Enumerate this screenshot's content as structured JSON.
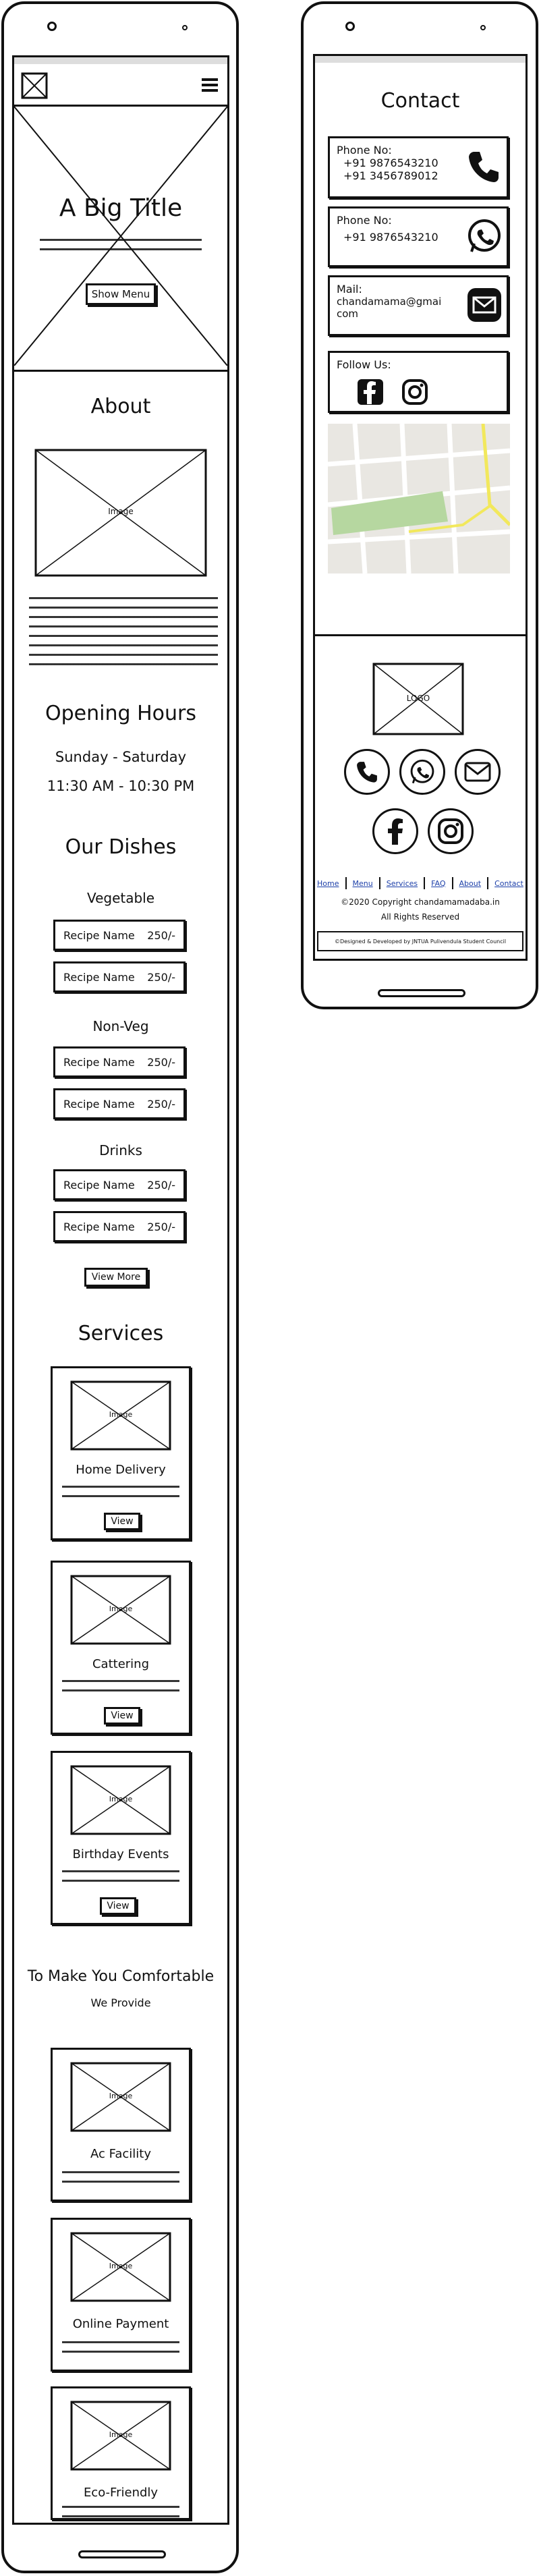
{
  "mobile_left": {
    "nav": {
      "logo_icon": "logo-placeholder-icon",
      "menu_icon": "hamburger-icon"
    },
    "hero": {
      "title": "A Big Title",
      "button": "Show Menu"
    },
    "about": {
      "heading": "About",
      "image_label": "Image"
    },
    "hours": {
      "heading": "Opening Hours",
      "days": "Sunday - Saturday",
      "time": "11:30 AM - 10:30 PM"
    },
    "dishes": {
      "heading": "Our Dishes",
      "groups": [
        {
          "title": "Vegetable",
          "items": [
            {
              "name": "Recipe Name",
              "price": "250/-"
            },
            {
              "name": "Recipe Name",
              "price": "250/-"
            }
          ]
        },
        {
          "title": "Non-Veg",
          "items": [
            {
              "name": "Recipe Name",
              "price": "250/-"
            },
            {
              "name": "Recipe Name",
              "price": "250/-"
            }
          ]
        },
        {
          "title": "Drinks",
          "items": [
            {
              "name": "Recipe Name",
              "price": "250/-"
            },
            {
              "name": "Recipe Name",
              "price": "250/-"
            }
          ]
        }
      ],
      "view_more": "View More"
    },
    "services": {
      "heading": "Services",
      "image_label": "Image",
      "view_label": "View",
      "items": [
        {
          "title": "Home Delivery"
        },
        {
          "title": "Cattering"
        },
        {
          "title": "Birthday Events"
        }
      ]
    },
    "comfort": {
      "heading": "To Make You Comfortable",
      "subheading": "We Provide",
      "image_label": "Image",
      "items": [
        {
          "title": "Ac Facility"
        },
        {
          "title": "Online Payment"
        },
        {
          "title": "Eco-Friendly"
        }
      ]
    }
  },
  "mobile_right": {
    "contact": {
      "heading": "Contact",
      "phone1_label": "Phone No:",
      "phone1_a": "+91 9876543210",
      "phone1_b": "+91 3456789012",
      "phone2_label": "Phone No:",
      "phone2": "+91 9876543210",
      "mail_label": "Mail:",
      "mail_a": "chandamama@gmai",
      "mail_b": "com",
      "follow_label": "Follow Us:"
    },
    "footer": {
      "logo_label": "LOGO",
      "links": [
        "Home",
        "Menu",
        "Services",
        "FAQ",
        "About",
        "Contact"
      ],
      "copyright": "©2020 Copyright chandamamadaba.in",
      "rights": "All Rights Reserved",
      "credit": "©Designed & Developed by JNTUA Pulivendula Student Council"
    }
  },
  "colors": {
    "ink": "#111111",
    "link": "#1b3ea8",
    "map_green": "#b6d7a0",
    "map_road": "#f2e85c",
    "map_bg": "#e9e7e2"
  }
}
